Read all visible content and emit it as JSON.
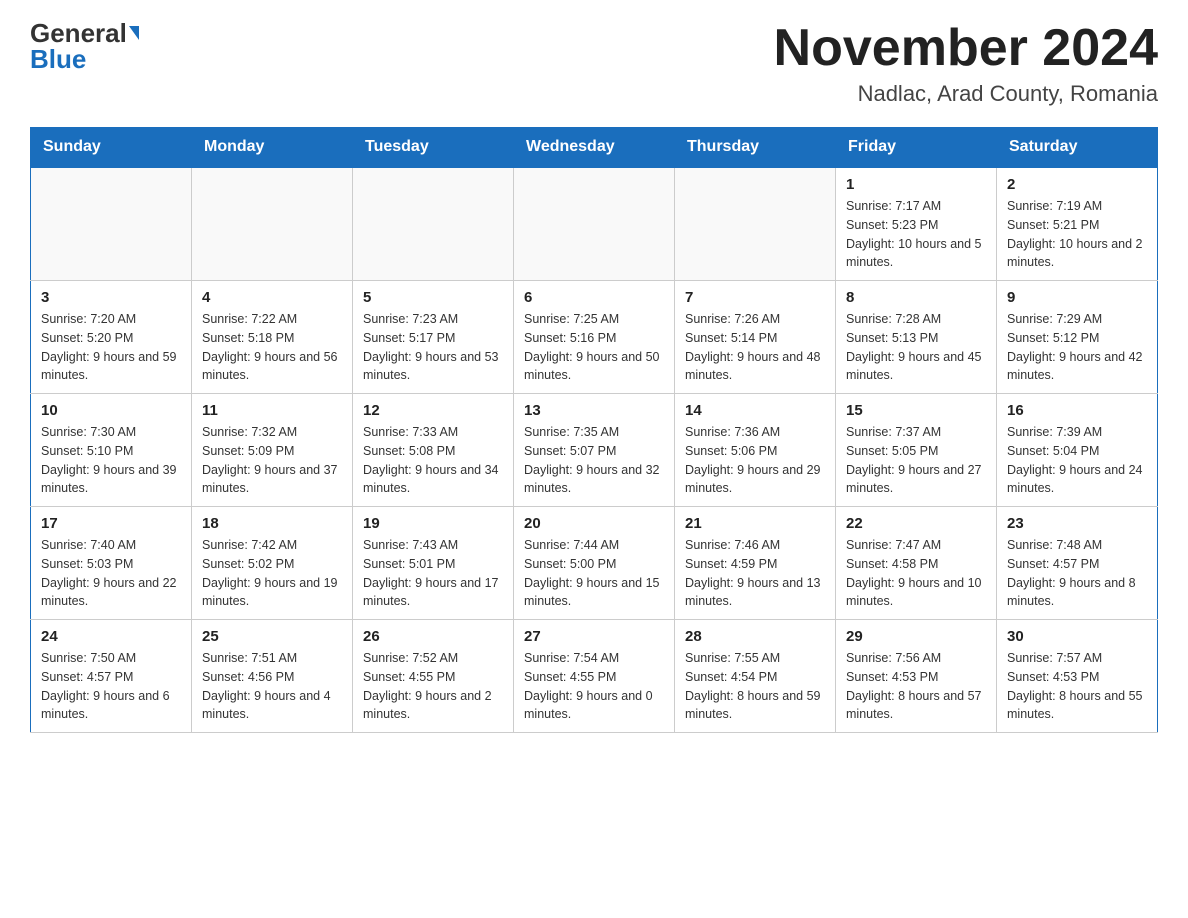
{
  "header": {
    "logo_general": "General",
    "logo_blue": "Blue",
    "month_title": "November 2024",
    "location": "Nadlac, Arad County, Romania"
  },
  "days_of_week": [
    "Sunday",
    "Monday",
    "Tuesday",
    "Wednesday",
    "Thursday",
    "Friday",
    "Saturday"
  ],
  "weeks": [
    [
      {
        "day": "",
        "sunrise": "",
        "sunset": "",
        "daylight": "",
        "empty": true
      },
      {
        "day": "",
        "sunrise": "",
        "sunset": "",
        "daylight": "",
        "empty": true
      },
      {
        "day": "",
        "sunrise": "",
        "sunset": "",
        "daylight": "",
        "empty": true
      },
      {
        "day": "",
        "sunrise": "",
        "sunset": "",
        "daylight": "",
        "empty": true
      },
      {
        "day": "",
        "sunrise": "",
        "sunset": "",
        "daylight": "",
        "empty": true
      },
      {
        "day": "1",
        "sunrise": "Sunrise: 7:17 AM",
        "sunset": "Sunset: 5:23 PM",
        "daylight": "Daylight: 10 hours and 5 minutes.",
        "empty": false
      },
      {
        "day": "2",
        "sunrise": "Sunrise: 7:19 AM",
        "sunset": "Sunset: 5:21 PM",
        "daylight": "Daylight: 10 hours and 2 minutes.",
        "empty": false
      }
    ],
    [
      {
        "day": "3",
        "sunrise": "Sunrise: 7:20 AM",
        "sunset": "Sunset: 5:20 PM",
        "daylight": "Daylight: 9 hours and 59 minutes.",
        "empty": false
      },
      {
        "day": "4",
        "sunrise": "Sunrise: 7:22 AM",
        "sunset": "Sunset: 5:18 PM",
        "daylight": "Daylight: 9 hours and 56 minutes.",
        "empty": false
      },
      {
        "day": "5",
        "sunrise": "Sunrise: 7:23 AM",
        "sunset": "Sunset: 5:17 PM",
        "daylight": "Daylight: 9 hours and 53 minutes.",
        "empty": false
      },
      {
        "day": "6",
        "sunrise": "Sunrise: 7:25 AM",
        "sunset": "Sunset: 5:16 PM",
        "daylight": "Daylight: 9 hours and 50 minutes.",
        "empty": false
      },
      {
        "day": "7",
        "sunrise": "Sunrise: 7:26 AM",
        "sunset": "Sunset: 5:14 PM",
        "daylight": "Daylight: 9 hours and 48 minutes.",
        "empty": false
      },
      {
        "day": "8",
        "sunrise": "Sunrise: 7:28 AM",
        "sunset": "Sunset: 5:13 PM",
        "daylight": "Daylight: 9 hours and 45 minutes.",
        "empty": false
      },
      {
        "day": "9",
        "sunrise": "Sunrise: 7:29 AM",
        "sunset": "Sunset: 5:12 PM",
        "daylight": "Daylight: 9 hours and 42 minutes.",
        "empty": false
      }
    ],
    [
      {
        "day": "10",
        "sunrise": "Sunrise: 7:30 AM",
        "sunset": "Sunset: 5:10 PM",
        "daylight": "Daylight: 9 hours and 39 minutes.",
        "empty": false
      },
      {
        "day": "11",
        "sunrise": "Sunrise: 7:32 AM",
        "sunset": "Sunset: 5:09 PM",
        "daylight": "Daylight: 9 hours and 37 minutes.",
        "empty": false
      },
      {
        "day": "12",
        "sunrise": "Sunrise: 7:33 AM",
        "sunset": "Sunset: 5:08 PM",
        "daylight": "Daylight: 9 hours and 34 minutes.",
        "empty": false
      },
      {
        "day": "13",
        "sunrise": "Sunrise: 7:35 AM",
        "sunset": "Sunset: 5:07 PM",
        "daylight": "Daylight: 9 hours and 32 minutes.",
        "empty": false
      },
      {
        "day": "14",
        "sunrise": "Sunrise: 7:36 AM",
        "sunset": "Sunset: 5:06 PM",
        "daylight": "Daylight: 9 hours and 29 minutes.",
        "empty": false
      },
      {
        "day": "15",
        "sunrise": "Sunrise: 7:37 AM",
        "sunset": "Sunset: 5:05 PM",
        "daylight": "Daylight: 9 hours and 27 minutes.",
        "empty": false
      },
      {
        "day": "16",
        "sunrise": "Sunrise: 7:39 AM",
        "sunset": "Sunset: 5:04 PM",
        "daylight": "Daylight: 9 hours and 24 minutes.",
        "empty": false
      }
    ],
    [
      {
        "day": "17",
        "sunrise": "Sunrise: 7:40 AM",
        "sunset": "Sunset: 5:03 PM",
        "daylight": "Daylight: 9 hours and 22 minutes.",
        "empty": false
      },
      {
        "day": "18",
        "sunrise": "Sunrise: 7:42 AM",
        "sunset": "Sunset: 5:02 PM",
        "daylight": "Daylight: 9 hours and 19 minutes.",
        "empty": false
      },
      {
        "day": "19",
        "sunrise": "Sunrise: 7:43 AM",
        "sunset": "Sunset: 5:01 PM",
        "daylight": "Daylight: 9 hours and 17 minutes.",
        "empty": false
      },
      {
        "day": "20",
        "sunrise": "Sunrise: 7:44 AM",
        "sunset": "Sunset: 5:00 PM",
        "daylight": "Daylight: 9 hours and 15 minutes.",
        "empty": false
      },
      {
        "day": "21",
        "sunrise": "Sunrise: 7:46 AM",
        "sunset": "Sunset: 4:59 PM",
        "daylight": "Daylight: 9 hours and 13 minutes.",
        "empty": false
      },
      {
        "day": "22",
        "sunrise": "Sunrise: 7:47 AM",
        "sunset": "Sunset: 4:58 PM",
        "daylight": "Daylight: 9 hours and 10 minutes.",
        "empty": false
      },
      {
        "day": "23",
        "sunrise": "Sunrise: 7:48 AM",
        "sunset": "Sunset: 4:57 PM",
        "daylight": "Daylight: 9 hours and 8 minutes.",
        "empty": false
      }
    ],
    [
      {
        "day": "24",
        "sunrise": "Sunrise: 7:50 AM",
        "sunset": "Sunset: 4:57 PM",
        "daylight": "Daylight: 9 hours and 6 minutes.",
        "empty": false
      },
      {
        "day": "25",
        "sunrise": "Sunrise: 7:51 AM",
        "sunset": "Sunset: 4:56 PM",
        "daylight": "Daylight: 9 hours and 4 minutes.",
        "empty": false
      },
      {
        "day": "26",
        "sunrise": "Sunrise: 7:52 AM",
        "sunset": "Sunset: 4:55 PM",
        "daylight": "Daylight: 9 hours and 2 minutes.",
        "empty": false
      },
      {
        "day": "27",
        "sunrise": "Sunrise: 7:54 AM",
        "sunset": "Sunset: 4:55 PM",
        "daylight": "Daylight: 9 hours and 0 minutes.",
        "empty": false
      },
      {
        "day": "28",
        "sunrise": "Sunrise: 7:55 AM",
        "sunset": "Sunset: 4:54 PM",
        "daylight": "Daylight: 8 hours and 59 minutes.",
        "empty": false
      },
      {
        "day": "29",
        "sunrise": "Sunrise: 7:56 AM",
        "sunset": "Sunset: 4:53 PM",
        "daylight": "Daylight: 8 hours and 57 minutes.",
        "empty": false
      },
      {
        "day": "30",
        "sunrise": "Sunrise: 7:57 AM",
        "sunset": "Sunset: 4:53 PM",
        "daylight": "Daylight: 8 hours and 55 minutes.",
        "empty": false
      }
    ]
  ]
}
